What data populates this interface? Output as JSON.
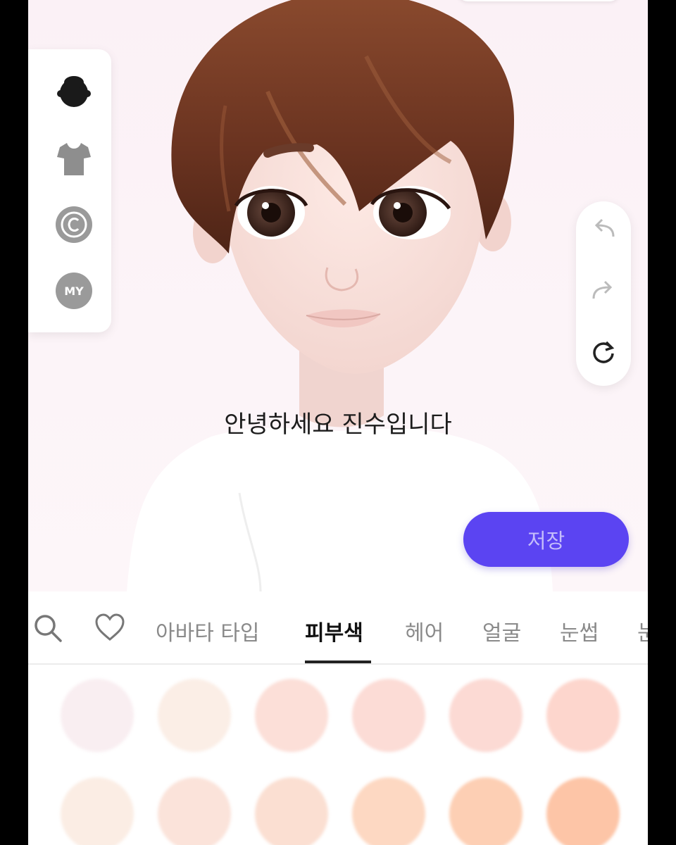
{
  "subtitle": "안녕하세요 진수입니다",
  "save_button": {
    "label": "저장",
    "color": "#5b44f2"
  },
  "left_toolbar": {
    "items": [
      {
        "name": "hair-category",
        "icon": "head-silhouette-icon",
        "selected": true
      },
      {
        "name": "clothing-category",
        "icon": "tshirt-icon",
        "selected": false
      },
      {
        "name": "copyright-category",
        "icon": "copyright-icon",
        "selected": false
      },
      {
        "name": "my-category",
        "icon": "my-badge-icon",
        "label": "MY",
        "selected": false
      }
    ]
  },
  "right_toolbar": {
    "items": [
      {
        "name": "undo",
        "icon": "undo-arrow-icon"
      },
      {
        "name": "redo",
        "icon": "redo-arrow-icon"
      },
      {
        "name": "reset",
        "icon": "refresh-icon"
      }
    ]
  },
  "tabs": {
    "icons": [
      {
        "name": "search",
        "icon": "search-icon"
      },
      {
        "name": "favorites",
        "icon": "heart-icon"
      }
    ],
    "items": [
      {
        "label": "아바타 타입"
      },
      {
        "label": "피부색",
        "active": true
      },
      {
        "label": "헤어"
      },
      {
        "label": "얼굴"
      },
      {
        "label": "눈썹"
      },
      {
        "label": "눈"
      }
    ]
  },
  "skin_swatches": {
    "row1": [
      "#f9eef1",
      "#fbeee6",
      "#fcdfd8",
      "#fcdcd6",
      "#fcdad4",
      "#fdd6cd"
    ],
    "row2": [
      "#fbede4",
      "#fbe3da",
      "#fbdfd2",
      "#fdd8c2",
      "#fdcfb4",
      "#fdc5a7"
    ]
  }
}
